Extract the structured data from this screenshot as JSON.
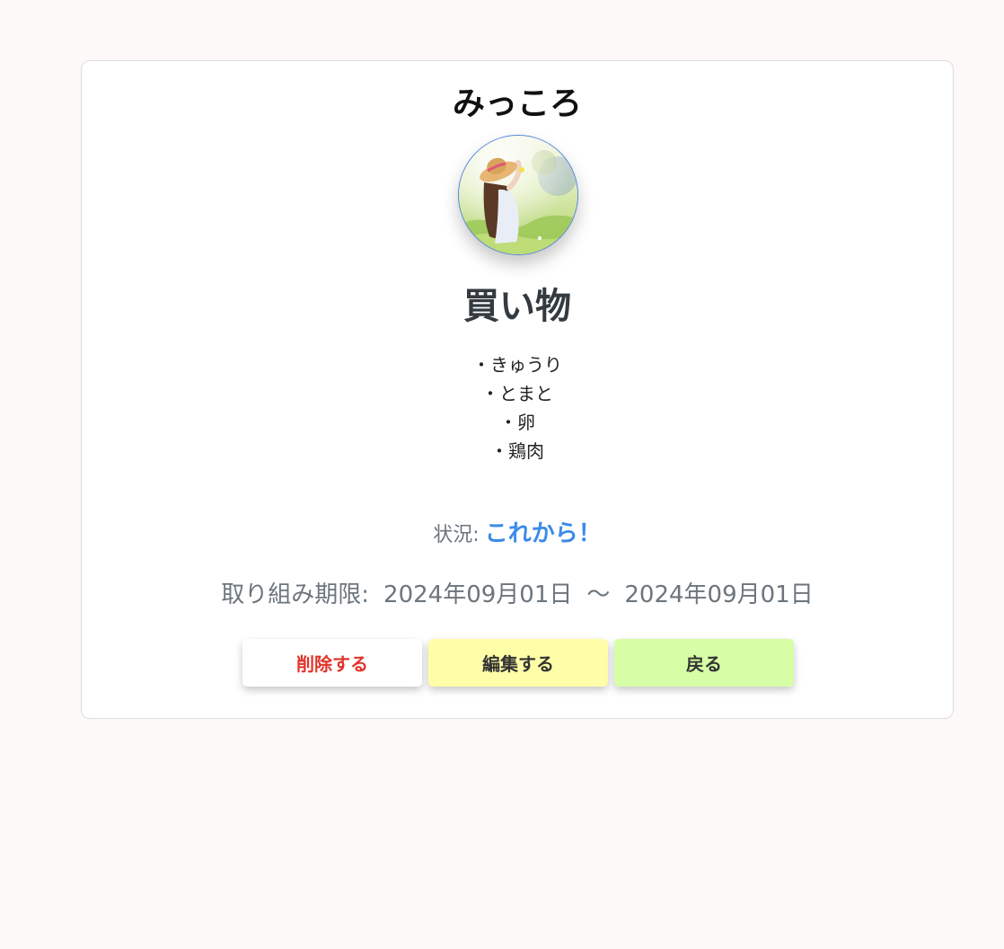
{
  "user": {
    "name": "みっころ",
    "avatar_alt": "avatar-photo"
  },
  "task": {
    "title": "買い物",
    "items": [
      "・きゅうり",
      "・とまと",
      "・卵",
      "・鶏肉"
    ]
  },
  "status": {
    "label": "状況:",
    "value": "これから！"
  },
  "deadline": {
    "label": "取り組み期限:",
    "start": "2024年09月01日",
    "separator": "〜",
    "end": "2024年09月01日"
  },
  "buttons": {
    "delete_label": "削除する",
    "edit_label": "編集する",
    "back_label": "戻る"
  },
  "colors": {
    "background": "#fdf9f8",
    "status_accent": "#3b8bea",
    "delete_text": "#e0342a",
    "edit_bg": "#fffea8",
    "back_bg": "#d7fea6"
  }
}
